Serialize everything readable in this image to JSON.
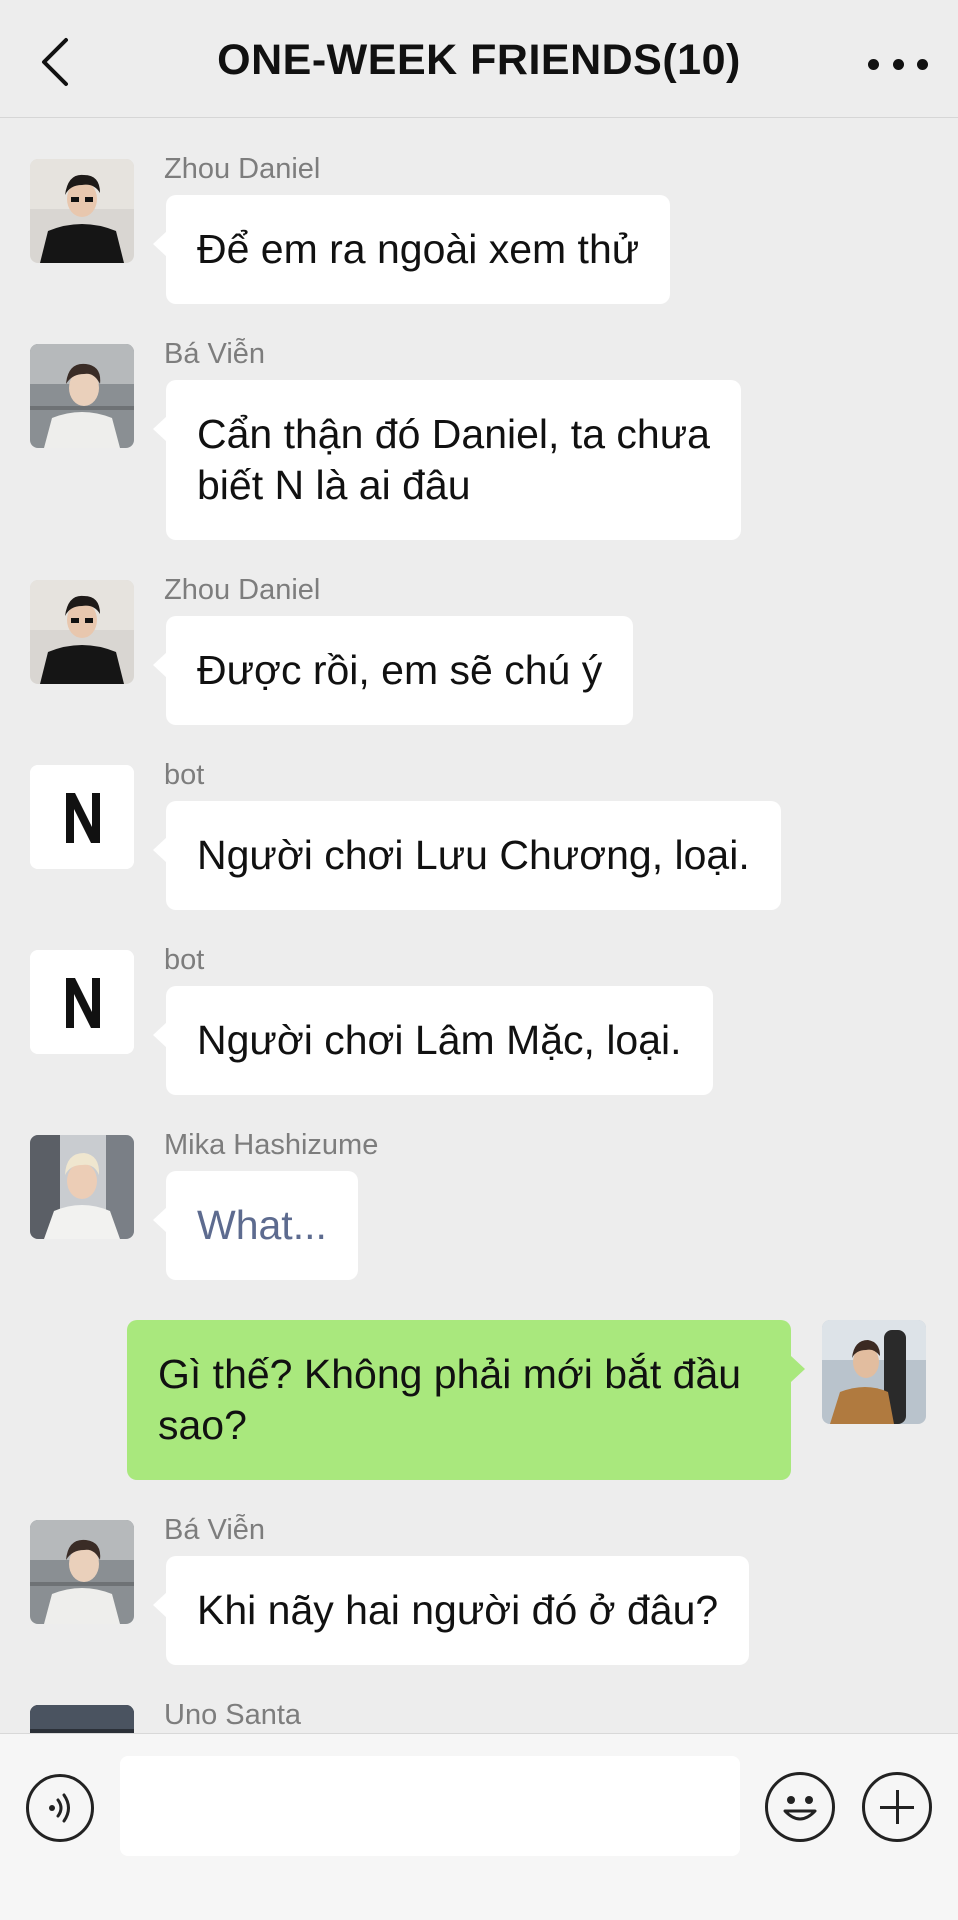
{
  "header": {
    "title": "ONE-WEEK FRIENDS(10)",
    "back_icon": "chevron-left-icon",
    "more_icon": "more-dots-icon"
  },
  "messages": [
    {
      "sender": "Zhou Daniel",
      "text": "Để em ra ngoài xem thử",
      "side": "left",
      "avatar": "photo-black-outfit"
    },
    {
      "sender": "Bá Viễn",
      "text_lines": [
        "Cẩn thận đó Daniel, ta chưa",
        "biết N là ai đâu"
      ],
      "side": "left",
      "avatar": "photo-light-outfit"
    },
    {
      "sender": "Zhou Daniel",
      "text": "Được rồi, em sẽ chú ý",
      "side": "left",
      "avatar": "photo-black-outfit"
    },
    {
      "sender": "bot",
      "text": "Người chơi Lưu Chương, loại.",
      "side": "left",
      "avatar": "n-logo"
    },
    {
      "sender": "bot",
      "text": "Người chơi Lâm Mặc, loại.",
      "side": "left",
      "avatar": "n-logo"
    },
    {
      "sender": "Mika Hashizume",
      "text": "What...",
      "side": "left",
      "avatar": "photo-blond-hair"
    },
    {
      "text_lines": [
        "Gì thế? Không phải mới bắt đầu",
        "sao?"
      ],
      "side": "right",
      "avatar": "photo-guitar"
    },
    {
      "sender": "Bá Viễn",
      "text": "Khi nãy hai người đó ở đâu?",
      "side": "left",
      "avatar": "photo-light-outfit"
    },
    {
      "sender": "Uno Santa",
      "side": "left",
      "avatar": "photo-dark"
    }
  ],
  "footer": {
    "input_value": "",
    "voice_icon": "voice-icon",
    "emoji_icon": "emoji-icon",
    "plus_icon": "plus-icon"
  },
  "colors": {
    "background": "#ededed",
    "bubble_left": "#ffffff",
    "bubble_right": "#a9e87d",
    "sender_text": "#7d7d7d",
    "link_text": "#5d6b8f"
  }
}
